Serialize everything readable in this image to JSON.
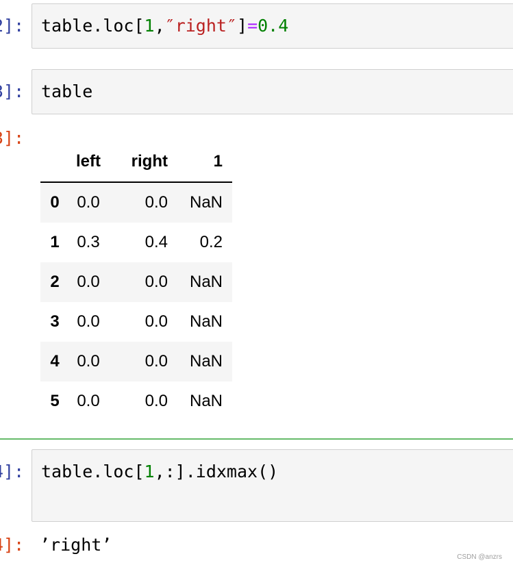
{
  "cells": [
    {
      "in_prompt": "2]:",
      "code_parts": [
        "table.loc[",
        "1",
        ",",
        "″right″",
        "]",
        "=",
        "0.4"
      ]
    },
    {
      "in_prompt": "3]:",
      "code_parts": [
        "table"
      ],
      "out_prompt": "3]:",
      "dataframe": {
        "columns": [
          "",
          "left",
          "right",
          "1"
        ],
        "rows": [
          {
            "index": "0",
            "left": "0.0",
            "right": "0.0",
            "one": "NaN"
          },
          {
            "index": "1",
            "left": "0.3",
            "right": "0.4",
            "one": "0.2"
          },
          {
            "index": "2",
            "left": "0.0",
            "right": "0.0",
            "one": "NaN"
          },
          {
            "index": "3",
            "left": "0.0",
            "right": "0.0",
            "one": "NaN"
          },
          {
            "index": "4",
            "left": "0.0",
            "right": "0.0",
            "one": "NaN"
          },
          {
            "index": "5",
            "left": "0.0",
            "right": "0.0",
            "one": "NaN"
          }
        ]
      }
    },
    {
      "in_prompt": "4]:",
      "code_parts": [
        "table.loc[",
        "1",
        ",:].idxmax()"
      ],
      "out_prompt": "4]:",
      "output_text": "’right’"
    }
  ],
  "watermark": "CSDN @anzrs",
  "colors": {
    "in_prompt": "#303f9f",
    "out_prompt": "#d84315",
    "number": "#008000",
    "string": "#ba2121",
    "operator": "#aa22ff",
    "active_cell_border": "#66bb6a"
  }
}
